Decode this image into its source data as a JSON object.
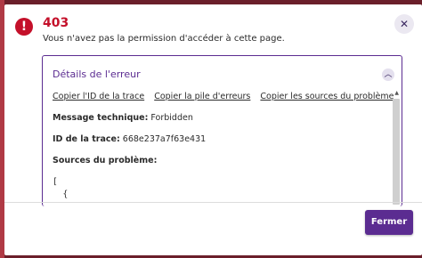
{
  "error": {
    "code": "403",
    "message": "Vous n'avez pas la permission d'accéder à cette page."
  },
  "details": {
    "title": "Détails de l'erreur",
    "links": [
      "Copier l'ID de la trace",
      "Copier la pile d'erreurs",
      "Copier les sources du problème"
    ],
    "technical_label": "Message technique:",
    "technical_value": "Forbidden",
    "trace_label": "ID de la trace:",
    "trace_value": "668e237a7f63e431",
    "sources_label": "Sources du problème:",
    "sources_code": "[\n  {"
  },
  "footer": {
    "close_label": "Fermer"
  },
  "colors": {
    "error_red": "#c4102a",
    "brand_purple": "#5b2c91"
  },
  "icons": {
    "alert": "alert-circle-icon",
    "close": "close-icon",
    "collapse": "chevron-up-icon"
  }
}
